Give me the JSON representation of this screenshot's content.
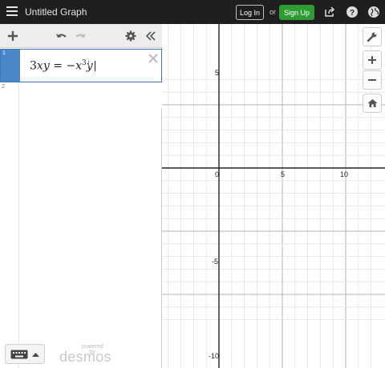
{
  "header": {
    "title": "Untitled Graph",
    "login_label": "Log In",
    "or_label": "or",
    "signup_label": "Sign Up",
    "icons": [
      "share-icon",
      "help-icon",
      "globe-icon"
    ]
  },
  "panel": {
    "toolbar_icons": [
      "plus-icon",
      "undo-icon",
      "redo-icon",
      "gear-icon",
      "collapse-icon"
    ],
    "expressions": [
      {
        "number": "1",
        "latex_parts": [
          "3",
          "x",
          "y",
          " = −",
          "x",
          "3",
          "y"
        ]
      },
      {
        "number": "2"
      }
    ],
    "powered_by": "powered by",
    "brand": "desmos"
  },
  "graph": {
    "x_labels": [
      "0",
      "5",
      "10"
    ],
    "y_labels": [
      "5",
      "-5",
      "-10"
    ],
    "x_range": [
      -9,
      12
    ],
    "y_range": [
      -12,
      7
    ],
    "grid_minor": 1,
    "grid_major": 5
  },
  "zoom_controls": [
    "wrench-icon",
    "zoom-in-icon",
    "zoom-out-icon",
    "home-icon"
  ],
  "colors": {
    "header_bg": "#1f1f1f",
    "signup_green": "#2f9b35",
    "selected_blue": "#4b86c8"
  }
}
